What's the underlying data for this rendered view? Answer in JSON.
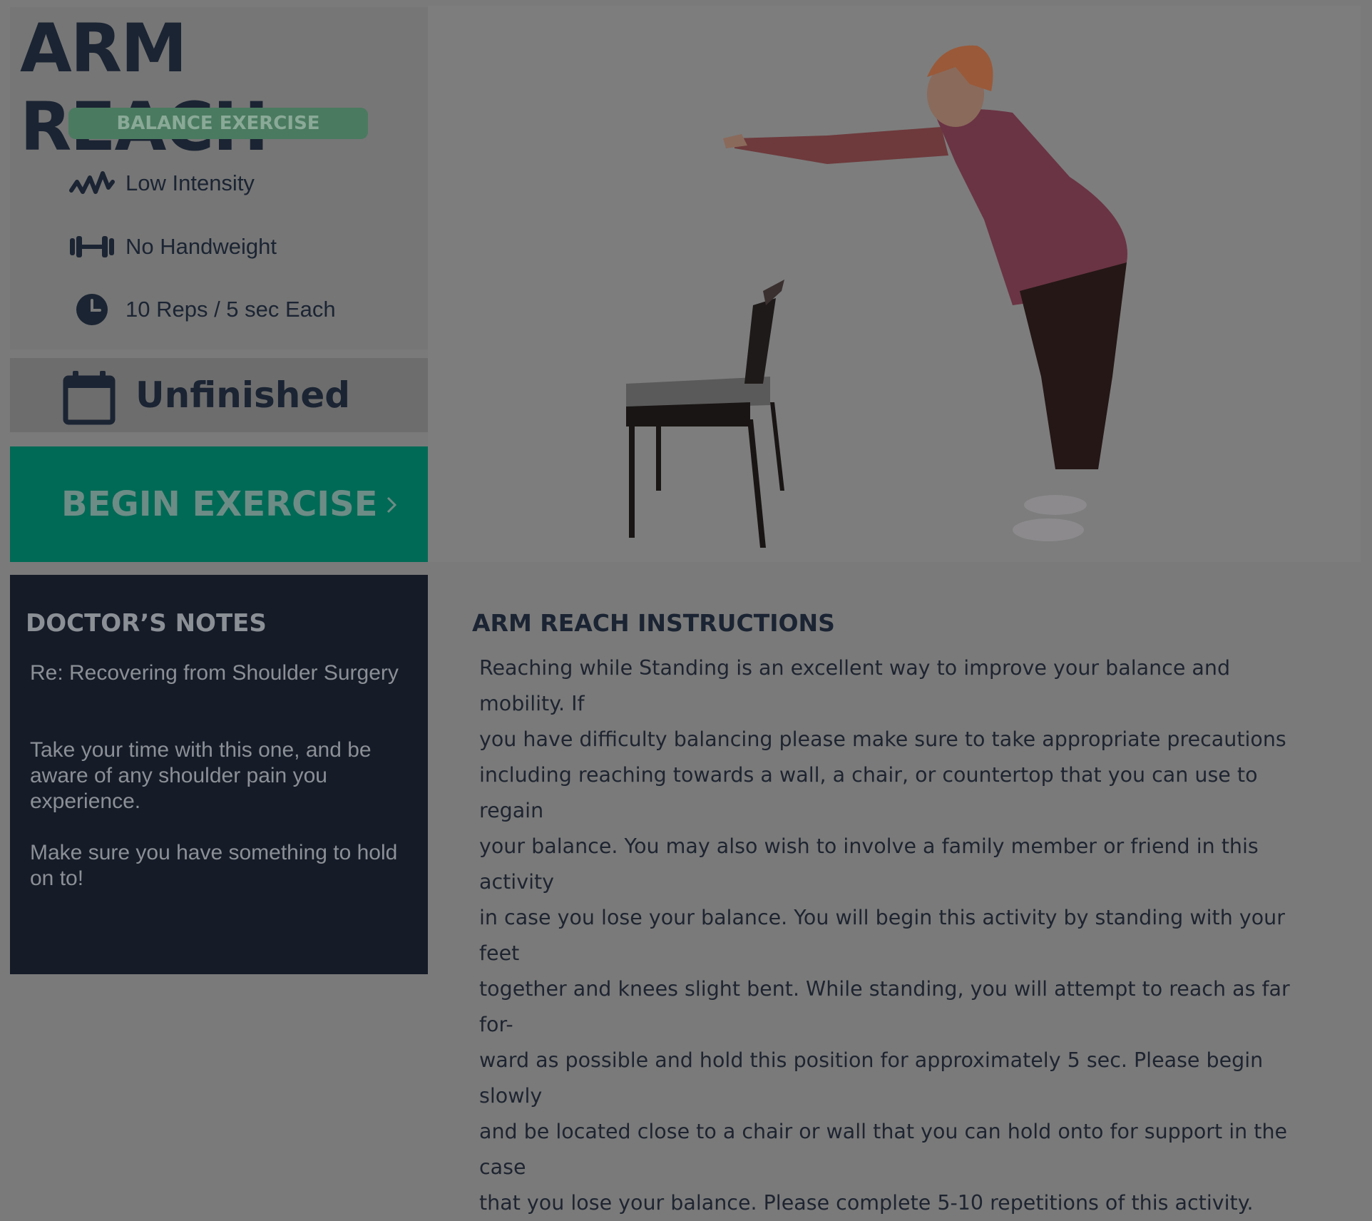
{
  "exercise": {
    "title": "ARM REACH",
    "category": "BALANCE EXERCISE",
    "attributes": [
      {
        "icon": "wave-icon",
        "label": "Low Intensity"
      },
      {
        "icon": "dumbbell-icon",
        "label": "No Handweight"
      },
      {
        "icon": "clock-icon",
        "label": "10 Reps / 5 sec Each"
      }
    ],
    "status": {
      "icon": "calendar-icon",
      "label": "Unfinished"
    },
    "begin_button": {
      "label": "BEGIN EXERCISE",
      "icon": "chevron-right-icon"
    }
  },
  "notes": {
    "title": "DOCTOR’S NOTES",
    "items": [
      "Re: Recovering from Shoulder Surgery",
      "Take your time with this one, and be aware of any shoulder pain you experience.",
      "Make sure you have something to hold on to!"
    ]
  },
  "instructions": {
    "title": "ARM REACH INSTRUCTIONS",
    "body": "Reaching while Standing is an excellent way to improve your balance and mobility. If\nyou have difficulty balancing please make sure to take appropriate precautions\nincluding reaching towards a wall, a chair, or countertop that you can use to regain\nyour balance. You may also wish to involve a family member or friend in this activity\nin case you lose your balance. You will begin this activity by standing with your feet\ntogether and knees slight bent. While standing, you will attempt to reach as far for-\nward as possible and hold this position for approximately 5 sec. Please begin slowly\nand be located close to a chair or wall that you can hold onto for support in the case\nthat you lose your balance. Please complete 5-10 repetitions of this activity."
  },
  "colors": {
    "page_bg": "#7a7a7a",
    "title": "#1b2432",
    "badge_bg": "#4a7a60",
    "button_bg": "#006a56",
    "notes_bg": "#161c27"
  }
}
